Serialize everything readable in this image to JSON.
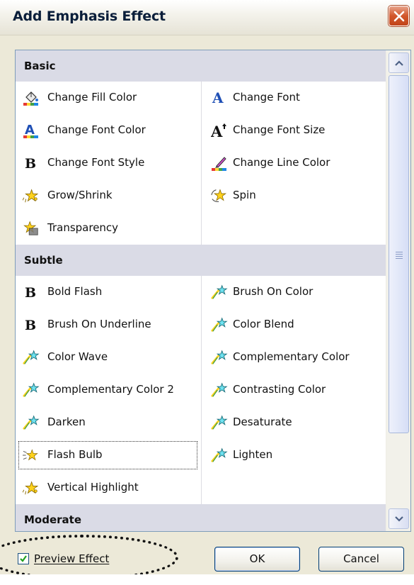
{
  "dialog": {
    "title": "Add Emphasis Effect",
    "close_icon": "close-x-icon"
  },
  "categories": [
    {
      "label": "Basic",
      "items": [
        {
          "label": "Change Fill Color",
          "icon": "paint-bucket-icon"
        },
        {
          "label": "Change Font",
          "icon": "font-a-icon"
        },
        {
          "label": "Change Font Color",
          "icon": "font-color-icon"
        },
        {
          "label": "Change Font Size",
          "icon": "font-size-icon"
        },
        {
          "label": "Change Font Style",
          "icon": "bold-b-icon"
        },
        {
          "label": "Change Line Color",
          "icon": "pen-line-color-icon"
        },
        {
          "label": "Grow/Shrink",
          "icon": "star-burst-icon"
        },
        {
          "label": "Spin",
          "icon": "spin-star-icon"
        },
        {
          "label": "Transparency",
          "icon": "star-box-icon"
        }
      ]
    },
    {
      "label": "Subtle",
      "items": [
        {
          "label": "Bold Flash",
          "icon": "bold-b-icon"
        },
        {
          "label": "Brush On Color",
          "icon": "shooting-star-icon"
        },
        {
          "label": "Brush On Underline",
          "icon": "bold-b-icon"
        },
        {
          "label": "Color Blend",
          "icon": "shooting-star-icon"
        },
        {
          "label": "Color Wave",
          "icon": "shooting-star-icon"
        },
        {
          "label": "Complementary Color",
          "icon": "shooting-star-icon"
        },
        {
          "label": "Complementary Color 2",
          "icon": "shooting-star-icon"
        },
        {
          "label": "Contrasting Color",
          "icon": "shooting-star-icon"
        },
        {
          "label": "Darken",
          "icon": "shooting-star-icon"
        },
        {
          "label": "Desaturate",
          "icon": "shooting-star-icon"
        },
        {
          "label": "Flash Bulb",
          "icon": "flash-star-icon",
          "selected": true
        },
        {
          "label": "Lighten",
          "icon": "shooting-star-icon"
        },
        {
          "label": "Vertical Highlight",
          "icon": "star-burst-icon"
        }
      ]
    },
    {
      "label": "Moderate",
      "items": []
    }
  ],
  "footer": {
    "preview_label": "Preview Effect",
    "preview_checked": true,
    "ok_label": "OK",
    "cancel_label": "Cancel"
  },
  "colors": {
    "dialog_bg": "#ECE9D8",
    "category_bg": "#DADBE6",
    "list_border": "#7F9DB9",
    "close_button": "#D2572B",
    "button_border": "#003C74"
  }
}
